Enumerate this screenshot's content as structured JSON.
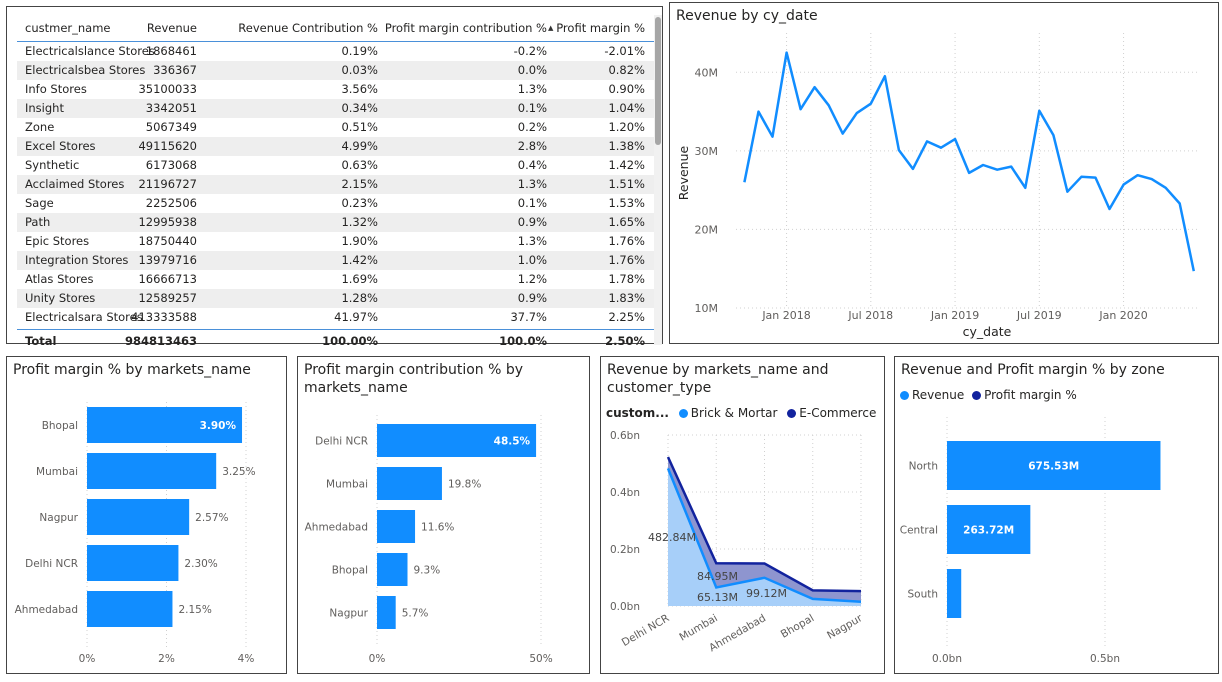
{
  "table": {
    "headers": [
      "custmer_name",
      "Revenue",
      "Revenue Contribution %",
      "Profit margin contribution %",
      "Profit margin %"
    ],
    "rows": [
      [
        "Electricalslance Stores",
        "1868461",
        "0.19%",
        "-0.2%",
        "-2.01%"
      ],
      [
        "Electricalsbea Stores",
        "336367",
        "0.03%",
        "0.0%",
        "0.82%"
      ],
      [
        "Info Stores",
        "35100033",
        "3.56%",
        "1.3%",
        "0.90%"
      ],
      [
        "Insight",
        "3342051",
        "0.34%",
        "0.1%",
        "1.04%"
      ],
      [
        "Zone",
        "5067349",
        "0.51%",
        "0.2%",
        "1.20%"
      ],
      [
        "Excel Stores",
        "49115620",
        "4.99%",
        "2.8%",
        "1.38%"
      ],
      [
        "Synthetic",
        "6173068",
        "0.63%",
        "0.4%",
        "1.42%"
      ],
      [
        "Acclaimed Stores",
        "21196727",
        "2.15%",
        "1.3%",
        "1.51%"
      ],
      [
        "Sage",
        "2252506",
        "0.23%",
        "0.1%",
        "1.53%"
      ],
      [
        "Path",
        "12995938",
        "1.32%",
        "0.9%",
        "1.65%"
      ],
      [
        "Epic Stores",
        "18750440",
        "1.90%",
        "1.3%",
        "1.76%"
      ],
      [
        "Integration Stores",
        "13979716",
        "1.42%",
        "1.0%",
        "1.76%"
      ],
      [
        "Atlas Stores",
        "16666713",
        "1.69%",
        "1.2%",
        "1.78%"
      ],
      [
        "Unity Stores",
        "12589257",
        "1.28%",
        "0.9%",
        "1.83%"
      ],
      [
        "Electricalsara Stores",
        "413333588",
        "41.97%",
        "37.7%",
        "2.25%"
      ]
    ],
    "total": [
      "Total",
      "984813463",
      "100.00%",
      "100.0%",
      "2.50%"
    ]
  },
  "titles": {
    "line": "Revenue by cy_date",
    "pm_markets": "Profit margin % by markets_name",
    "pmc_markets_1": "Profit margin contribution % by",
    "pmc_markets_2": "markets_name",
    "area_1": "Revenue by markets_name and",
    "area_2": "customer_type",
    "zone": "Revenue and Profit margin % by zone"
  },
  "legends": {
    "area_title": "custom...",
    "area_s1": "Brick & Mortar",
    "area_s2": "E-Commerce",
    "zone_s1": "Revenue",
    "zone_s2": "Profit margin %"
  },
  "colors": {
    "primary": "#118dff",
    "dark": "#12239e",
    "light_area": "#a7cff9"
  },
  "chart_data": [
    {
      "type": "line",
      "title": "Revenue by cy_date",
      "xlabel": "cy_date",
      "ylabel": "Revenue",
      "y_ticks": [
        "10M",
        "20M",
        "30M",
        "40M"
      ],
      "x_ticks": [
        "Jan 2018",
        "Jul 2018",
        "Jan 2019",
        "Jul 2019",
        "Jan 2020"
      ],
      "ylim": [
        10,
        45
      ],
      "x": [
        "2017-10",
        "2017-11",
        "2017-12",
        "2018-01",
        "2018-02",
        "2018-03",
        "2018-04",
        "2018-05",
        "2018-06",
        "2018-07",
        "2018-08",
        "2018-09",
        "2018-10",
        "2018-11",
        "2018-12",
        "2019-01",
        "2019-02",
        "2019-03",
        "2019-04",
        "2019-05",
        "2019-06",
        "2019-07",
        "2019-08",
        "2019-09",
        "2019-10",
        "2019-11",
        "2019-12",
        "2020-01",
        "2020-02",
        "2020-03",
        "2020-04",
        "2020-05",
        "2020-06"
      ],
      "values": [
        26.0,
        35.0,
        31.8,
        42.5,
        35.3,
        38.1,
        35.8,
        32.2,
        34.8,
        36.0,
        39.5,
        30.1,
        27.7,
        31.2,
        30.4,
        31.5,
        27.2,
        28.2,
        27.6,
        28.0,
        25.3,
        35.1,
        32.0,
        24.8,
        26.7,
        26.6,
        22.6,
        25.7,
        26.9,
        26.4,
        25.3,
        23.3,
        14.7
      ]
    },
    {
      "type": "bar",
      "title": "Profit margin % by markets_name",
      "categories": [
        "Bhopal",
        "Mumbai",
        "Nagpur",
        "Delhi NCR",
        "Ahmedabad"
      ],
      "values": [
        3.9,
        3.25,
        2.57,
        2.3,
        2.15
      ],
      "labels": [
        "3.90%",
        "3.25%",
        "2.57%",
        "2.30%",
        "2.15%"
      ],
      "x_ticks": [
        "0%",
        "2%",
        "4%"
      ],
      "xlim": [
        0,
        4
      ]
    },
    {
      "type": "bar",
      "title": "Profit margin contribution % by markets_name",
      "categories": [
        "Delhi NCR",
        "Mumbai",
        "Ahmedabad",
        "Bhopal",
        "Nagpur"
      ],
      "values": [
        48.5,
        19.8,
        11.6,
        9.3,
        5.7
      ],
      "labels": [
        "48.5%",
        "19.8%",
        "11.6%",
        "9.3%",
        "5.7%"
      ],
      "x_ticks": [
        "0%",
        "50%"
      ],
      "xlim": [
        0,
        50
      ]
    },
    {
      "type": "area",
      "title": "Revenue by markets_name and customer_type",
      "categories": [
        "Delhi NCR",
        "Mumbai",
        "Ahmedabad",
        "Bhopal",
        "Nagpur"
      ],
      "y_ticks": [
        "0.0bn",
        "0.2bn",
        "0.4bn",
        "0.6bn"
      ],
      "ylim": [
        0,
        0.6
      ],
      "series": [
        {
          "name": "Brick & Mortar",
          "values": [
            0.48284,
            0.06513,
            0.09912,
            0.025,
            0.015
          ]
        },
        {
          "name": "E-Commerce",
          "values": [
            0.04,
            0.08495,
            0.05,
            0.03,
            0.037
          ]
        }
      ],
      "data_labels": [
        "482.84M",
        "84.95M",
        "65.13M",
        "99.12M"
      ]
    },
    {
      "type": "bar",
      "title": "Revenue and Profit margin % by zone",
      "categories": [
        "North",
        "Central",
        "South"
      ],
      "series": [
        {
          "name": "Revenue",
          "values": [
            675.53,
            263.72,
            45
          ]
        }
      ],
      "labels": [
        "675.53M",
        "263.72M",
        ""
      ],
      "x_ticks": [
        "0.0bn",
        "0.5bn"
      ],
      "xlim": [
        0,
        0.85
      ]
    }
  ]
}
